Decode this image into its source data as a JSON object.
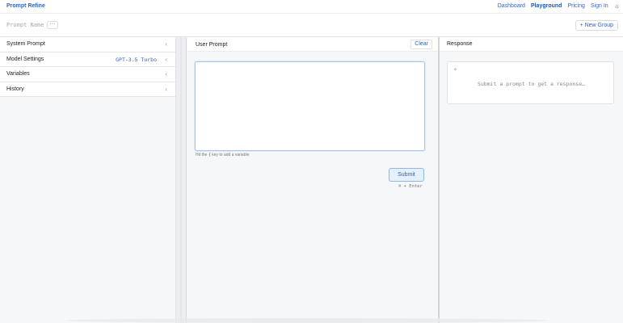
{
  "app": {
    "title": "Prompt Refine"
  },
  "nav": {
    "dashboard": "Dashboard",
    "playground": "Playground",
    "pricing": "Pricing",
    "sign_in": "Sign In",
    "theme_icon": "sun-icon"
  },
  "toolbar": {
    "prompt_name_placeholder": "Prompt Name",
    "more_label": "···",
    "new_group_label": "+ New Group"
  },
  "sidebar": {
    "items": [
      {
        "label": "System Prompt",
        "value": ""
      },
      {
        "label": "Model Settings",
        "value": "GPT-3.5 Turbo"
      },
      {
        "label": "Variables",
        "value": ""
      },
      {
        "label": "History",
        "value": ""
      }
    ],
    "chevron": "‹"
  },
  "user_prompt": {
    "title": "User Prompt",
    "clear_label": "Clear",
    "value": "",
    "hint_prefix": "Hit the",
    "hint_key": "{",
    "hint_suffix": "key to add a variable",
    "submit_label": "Submit",
    "shortcut": "⌘ + Enter"
  },
  "response": {
    "title": "Response",
    "placeholder": "Submit a prompt to get a response…"
  },
  "colors": {
    "accent": "#2f64c7",
    "submit_bg": "#e4f0fc"
  }
}
